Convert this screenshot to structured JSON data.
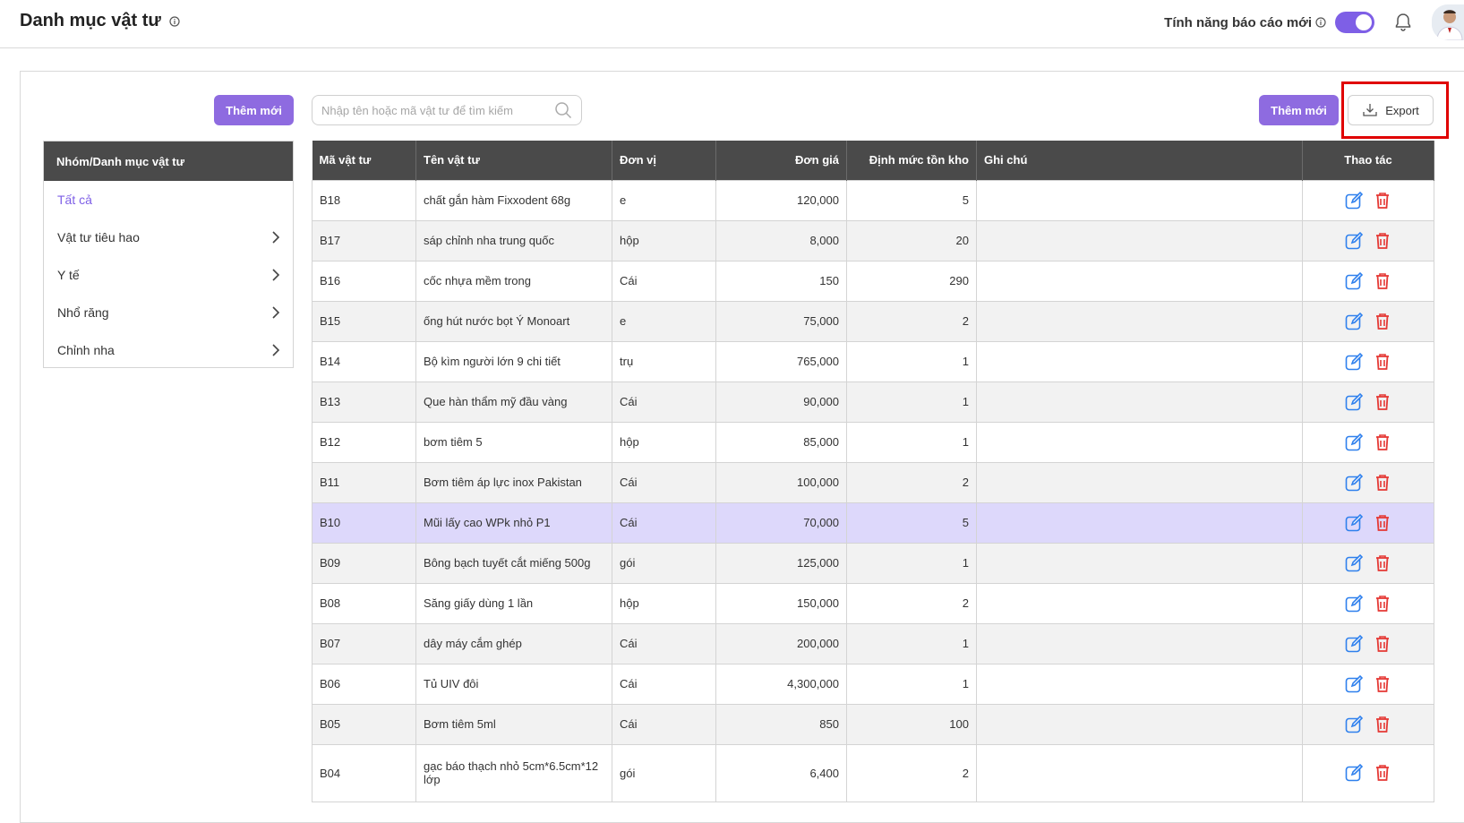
{
  "header": {
    "title": "Danh mục vật tư",
    "feature_label": "Tính năng báo cáo mới",
    "toggle_on": true,
    "colors": {
      "accent": "#7e5fe6",
      "header_bg": "#4a4a4a",
      "highlight_row": "#ddd8fb",
      "edit_icon": "#2f80ed",
      "delete_icon": "#e53935"
    }
  },
  "toolbar": {
    "add_left_label": "Thêm mới",
    "search_placeholder": "Nhập tên hoặc mã vật tư để tìm kiếm",
    "add_right_label": "Thêm mới",
    "export_label": "Export"
  },
  "categories": {
    "header": "Nhóm/Danh mục vật tư",
    "items": [
      {
        "label": "Tất cả",
        "active": true,
        "has_children": false
      },
      {
        "label": "Vật tư tiêu hao",
        "has_children": true
      },
      {
        "label": "Y tế",
        "has_children": true
      },
      {
        "label": "Nhổ răng",
        "has_children": true
      },
      {
        "label": "Chỉnh nha",
        "has_children": true
      }
    ]
  },
  "table": {
    "columns": [
      "Mã vật tư",
      "Tên vật tư",
      "Đơn vị",
      "Đơn giá",
      "Định mức tồn kho",
      "Ghi chú",
      "Thao tác"
    ],
    "rows": [
      {
        "code": "B18",
        "name": "chất gắn hàm Fixxodent 68g",
        "unit": "e",
        "price": "120,000",
        "stock": "5",
        "note": ""
      },
      {
        "code": "B17",
        "name": "sáp chỉnh nha trung quốc",
        "unit": "hộp",
        "price": "8,000",
        "stock": "20",
        "note": ""
      },
      {
        "code": "B16",
        "name": "cốc nhựa mềm trong",
        "unit": "Cái",
        "price": "150",
        "stock": "290",
        "note": ""
      },
      {
        "code": "B15",
        "name": "ống hút nước bọt Ý Monoart",
        "unit": "e",
        "price": "75,000",
        "stock": "2",
        "note": ""
      },
      {
        "code": "B14",
        "name": "Bộ kìm người lớn 9 chi tiết",
        "unit": "trụ",
        "price": "765,000",
        "stock": "1",
        "note": ""
      },
      {
        "code": "B13",
        "name": "Que hàn thẩm mỹ đầu vàng",
        "unit": "Cái",
        "price": "90,000",
        "stock": "1",
        "note": ""
      },
      {
        "code": "B12",
        "name": "bơm tiêm 5",
        "unit": "hộp",
        "price": "85,000",
        "stock": "1",
        "note": ""
      },
      {
        "code": "B11",
        "name": "Bơm tiêm áp lực inox Pakistan",
        "unit": "Cái",
        "price": "100,000",
        "stock": "2",
        "note": ""
      },
      {
        "code": "B10",
        "name": "Mũi lấy cao WPk nhỏ P1",
        "unit": "Cái",
        "price": "70,000",
        "stock": "5",
        "note": "",
        "highlighted": true
      },
      {
        "code": "B09",
        "name": "Bông bạch tuyết cắt miếng 500g",
        "unit": "gói",
        "price": "125,000",
        "stock": "1",
        "note": ""
      },
      {
        "code": "B08",
        "name": "Săng giấy dùng 1 lần",
        "unit": "hộp",
        "price": "150,000",
        "stock": "2",
        "note": ""
      },
      {
        "code": "B07",
        "name": "dây máy cắm ghép",
        "unit": "Cái",
        "price": "200,000",
        "stock": "1",
        "note": ""
      },
      {
        "code": "B06",
        "name": "Tủ UIV đôi",
        "unit": "Cái",
        "price": "4,300,000",
        "stock": "1",
        "note": ""
      },
      {
        "code": "B05",
        "name": "Bơm tiêm 5ml",
        "unit": "Cái",
        "price": "850",
        "stock": "100",
        "note": ""
      },
      {
        "code": "B04",
        "name": "gạc báo thạch nhỏ 5cm*6.5cm*12 lớp",
        "unit": "gói",
        "price": "6,400",
        "stock": "2",
        "note": ""
      }
    ]
  }
}
